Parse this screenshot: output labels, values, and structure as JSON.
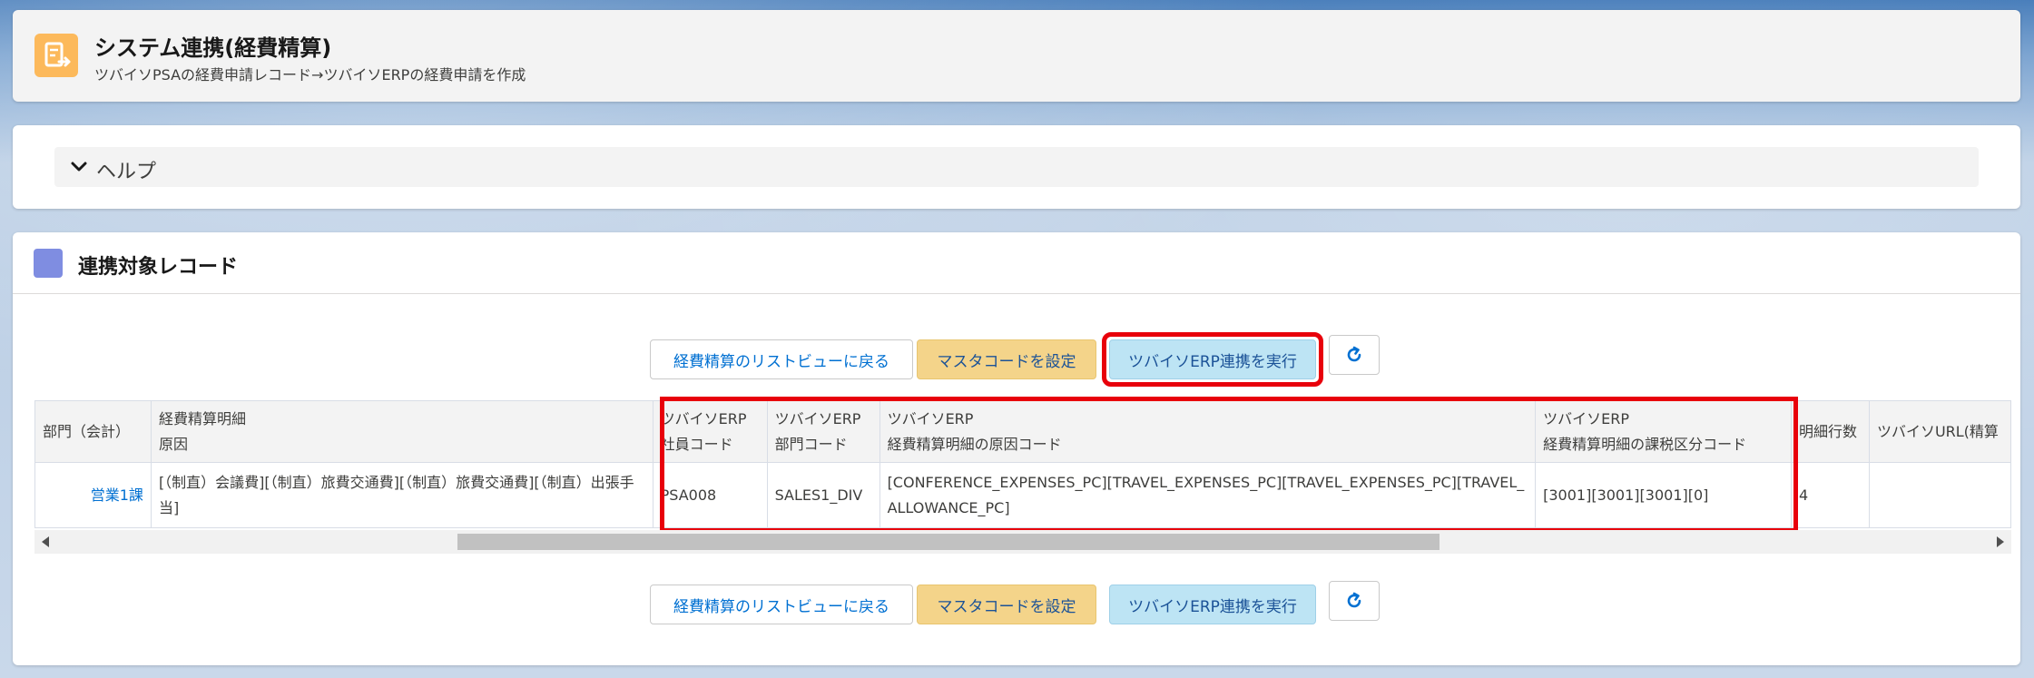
{
  "header": {
    "title": "システム連携(経費精算)",
    "subtitle": "ツバイソPSAの経費申請レコード→ツバイソERPの経費申請を作成",
    "icon": "expense-upload-icon",
    "icon_color": "#fcb95b"
  },
  "help": {
    "label": "ヘルプ",
    "icon": "chevron-down-icon"
  },
  "main": {
    "title": "連携対象レコード",
    "icon_color": "#7f8de1"
  },
  "toolbar": {
    "back_label": "経費精算のリストビューに戻る",
    "master_label": "マスタコードを設定",
    "exec_label": "ツバイソERP連携を実行",
    "refresh_icon": "refresh-icon"
  },
  "table": {
    "headers": {
      "dept": "部門（会計）",
      "detail_l1": "経費精算明細",
      "detail_l2": "原因",
      "emp_l1": "ツバイソERP",
      "emp_l2": "社員コード",
      "deptcode_l1": "ツバイソERP",
      "deptcode_l2": "部門コード",
      "reason_l1": "ツバイソERP",
      "reason_l2": "経費精算明細の原因コード",
      "tax_l1": "ツバイソERP",
      "tax_l2": "経費精算明細の課税区分コード",
      "lines": "明細行数",
      "url": "ツバイソURL(精算"
    },
    "row": {
      "dept": "営業1課",
      "detail": "[（制直）会議費][（制直）旅費交通費][（制直）旅費交通費][（制直）出張手当]",
      "emp": "PSA008",
      "deptcode": "SALES1_DIV",
      "reason": "[CONFERENCE_EXPENSES_PC][TRAVEL_EXPENSES_PC][TRAVEL_EXPENSES_PC][TRAVEL_ALLOWANCE_PC]",
      "tax": "[3001][3001][3001][0]",
      "lines": "4",
      "url": ""
    }
  },
  "colors": {
    "highlight": "#e8000b",
    "link": "#0070d2"
  }
}
